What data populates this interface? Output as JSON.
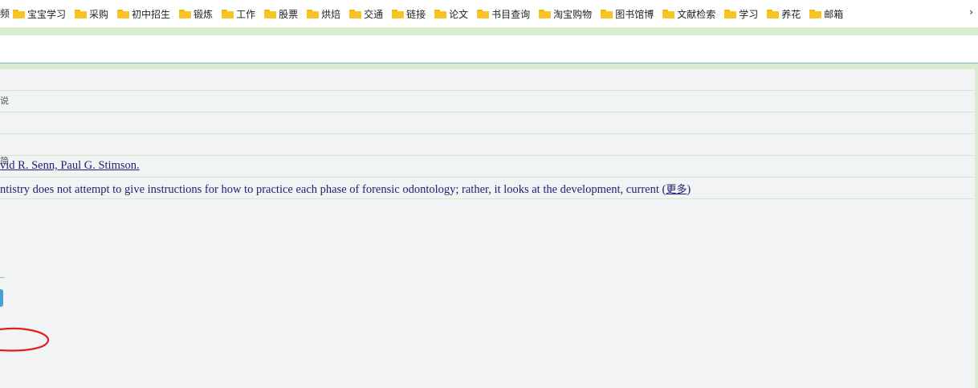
{
  "bookmarks": {
    "cut_off_left": "频",
    "items": [
      "宝宝学习",
      "采购",
      "初中招生",
      "锻炼",
      "工作",
      "股票",
      "烘焙",
      "交通",
      "链接",
      "论文",
      "书目查询",
      "淘宝购物",
      "图书馆博",
      "文献检索",
      "学习",
      "养花",
      "邮箱"
    ],
    "folder_color": "#f7c325"
  },
  "record": {
    "side_mark": "说",
    "side_mark2": "简",
    "authors": "vid R. Senn, Paul G. Stimson.",
    "summary": "ntistry does not attempt to give instructions for how to practice each phase of forensic odontology; rather, it looks at the development, current",
    "more_open": "(",
    "more_label": "更多",
    "more_close": ")"
  },
  "colors": {
    "accent_green": "#d9ecd2",
    "link_text": "#1f1f70",
    "annotation_red": "#e02020"
  }
}
